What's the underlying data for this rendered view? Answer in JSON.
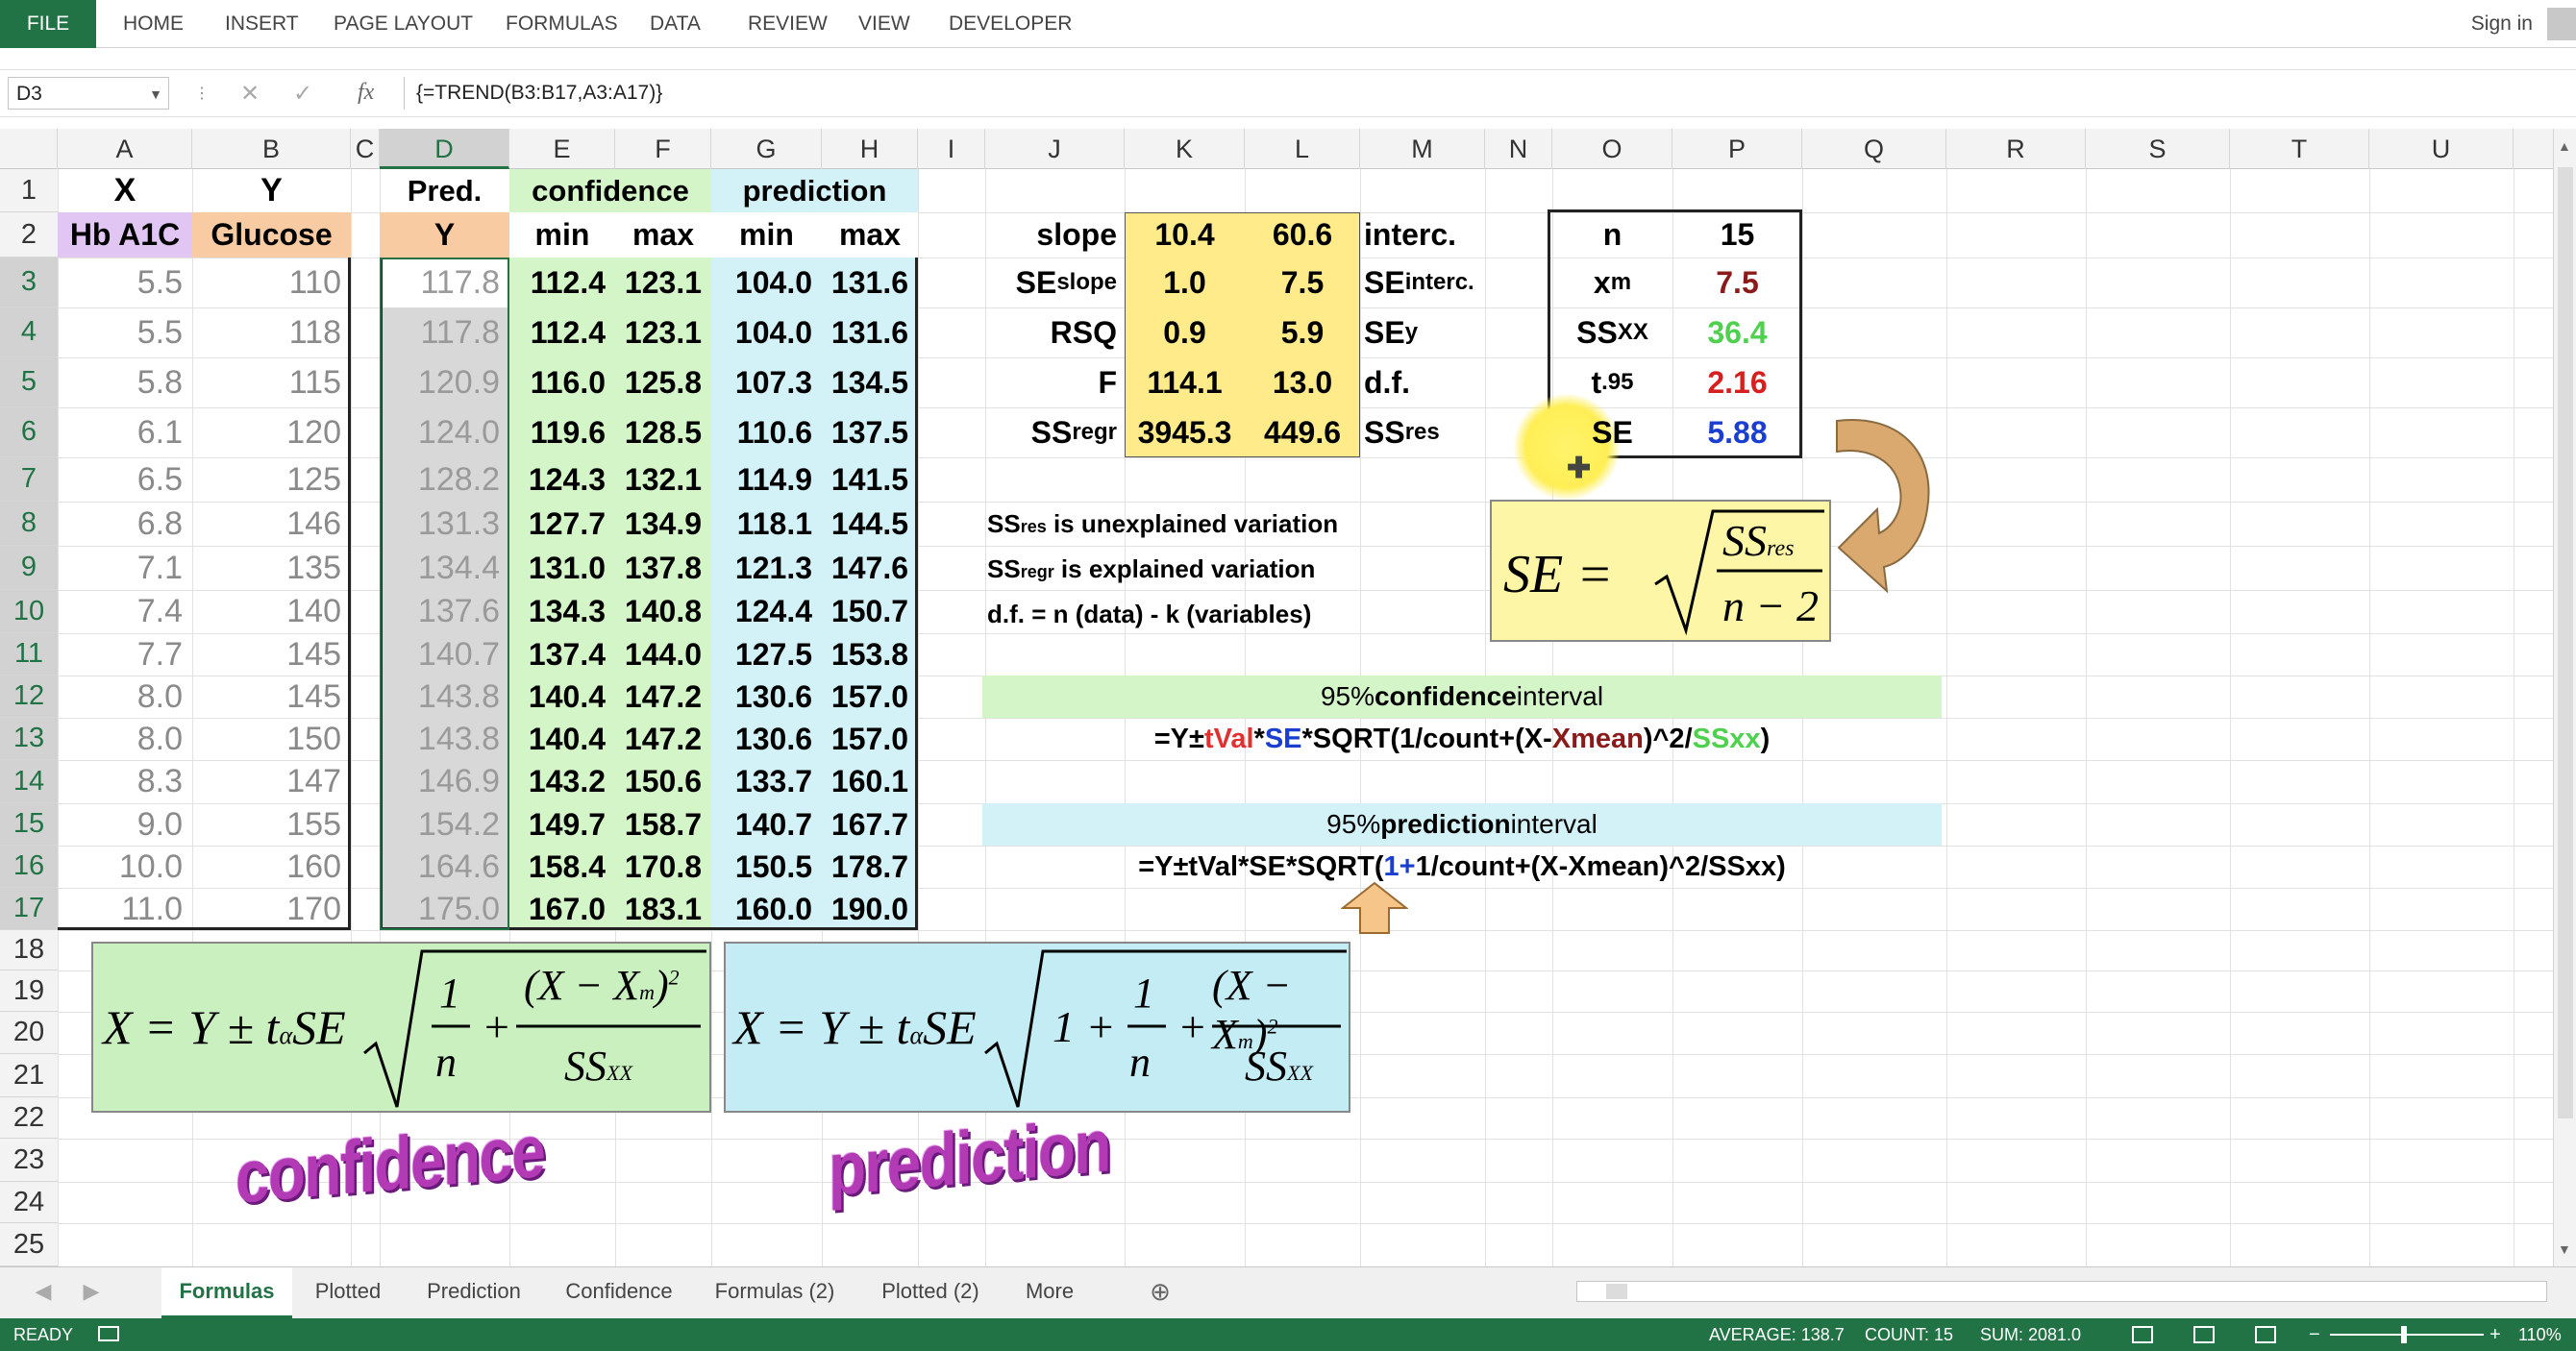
{
  "ribbon": {
    "file": "FILE",
    "tabs": [
      "HOME",
      "INSERT",
      "PAGE LAYOUT",
      "FORMULAS",
      "DATA",
      "REVIEW",
      "VIEW",
      "DEVELOPER"
    ],
    "signin": "Sign in"
  },
  "formula_bar": {
    "name_box": "D3",
    "cancel": "✕",
    "enter": "✓",
    "fx": "fx",
    "formula": "{=TREND(B3:B17,A3:A17)}"
  },
  "columns": [
    "A",
    "B",
    "C",
    "D",
    "E",
    "F",
    "G",
    "H",
    "I",
    "J",
    "K",
    "L",
    "M",
    "N",
    "O",
    "P",
    "Q",
    "R",
    "S",
    "T",
    "U"
  ],
  "rows": [
    "1",
    "2",
    "3",
    "4",
    "5",
    "6",
    "7",
    "8",
    "9",
    "10",
    "11",
    "12",
    "13",
    "14",
    "15",
    "16",
    "17",
    "18",
    "19",
    "20",
    "21",
    "22",
    "23",
    "24",
    "25"
  ],
  "headers": {
    "x": "X",
    "y": "Y",
    "hba1c": "Hb A1C",
    "glucose": "Glucose",
    "pred": "Pred.",
    "pred_y": "Y",
    "confidence": "confidence",
    "prediction": "prediction",
    "min": "min",
    "max": "max"
  },
  "table": [
    [
      "5.5",
      "110",
      "117.8",
      "112.4",
      "123.1",
      "104.0",
      "131.6"
    ],
    [
      "5.5",
      "118",
      "117.8",
      "112.4",
      "123.1",
      "104.0",
      "131.6"
    ],
    [
      "5.8",
      "115",
      "120.9",
      "116.0",
      "125.8",
      "107.3",
      "134.5"
    ],
    [
      "6.1",
      "120",
      "124.0",
      "119.6",
      "128.5",
      "110.6",
      "137.5"
    ],
    [
      "6.5",
      "125",
      "128.2",
      "124.3",
      "132.1",
      "114.9",
      "141.5"
    ],
    [
      "6.8",
      "146",
      "131.3",
      "127.7",
      "134.9",
      "118.1",
      "144.5"
    ],
    [
      "7.1",
      "135",
      "134.4",
      "131.0",
      "137.8",
      "121.3",
      "147.6"
    ],
    [
      "7.4",
      "140",
      "137.6",
      "134.3",
      "140.8",
      "124.4",
      "150.7"
    ],
    [
      "7.7",
      "145",
      "140.7",
      "137.4",
      "144.0",
      "127.5",
      "153.8"
    ],
    [
      "8.0",
      "145",
      "143.8",
      "140.4",
      "147.2",
      "130.6",
      "157.0"
    ],
    [
      "8.0",
      "150",
      "143.8",
      "140.4",
      "147.2",
      "130.6",
      "157.0"
    ],
    [
      "8.3",
      "147",
      "146.9",
      "143.2",
      "150.6",
      "133.7",
      "160.1"
    ],
    [
      "9.0",
      "155",
      "154.2",
      "149.7",
      "158.7",
      "140.7",
      "167.7"
    ],
    [
      "10.0",
      "160",
      "164.6",
      "158.4",
      "170.8",
      "150.5",
      "178.7"
    ],
    [
      "11.0",
      "170",
      "175.0",
      "167.0",
      "183.1",
      "160.0",
      "190.0"
    ]
  ],
  "stats": {
    "slope": "slope",
    "slope_val": "10.4",
    "interc_val": "60.6",
    "interc": "interc.",
    "se": "SE",
    "se_slope_sub": "slope",
    "se_slope_val": "1.0",
    "se_interc_val": "7.5",
    "se_interc_sub": "interc.",
    "rsq": "RSQ",
    "rsq_val": "0.9",
    "sey_val": "5.9",
    "se_y_sub": "y",
    "f": "F",
    "f_val": "114.1",
    "df_val": "13.0",
    "df": "d.f.",
    "ss": "SS",
    "ss_regr_sub": "regr",
    "ss_regr_val": "3945.3",
    "ss_res_val": "449.6",
    "ss_res_sub": "res"
  },
  "box": {
    "n": "n",
    "n_val": "15",
    "xm": "x",
    "xm_sub": "m",
    "xm_val": "7.5",
    "ssxx": "SS",
    "ssxx_sub": "XX",
    "ssxx_val": "36.4",
    "t": "t",
    "t_sub": ".95",
    "t_val": "2.16",
    "se": "SE",
    "se_val": "5.88"
  },
  "notes": {
    "res_label": "SS",
    "res_sub": "res",
    "res_text": " is unexplained variation",
    "regr_label": "SS",
    "regr_sub": "regr",
    "regr_text": " is explained variation",
    "df_text": "d.f. = n (data) - k (variables)"
  },
  "conf_interval": {
    "pre": "95% ",
    "bold": "confidence",
    "post": " interval",
    "f1": "=Y±",
    "f2": "tVal",
    "f3": "*",
    "f4": "SE",
    "f5": "*SQRT(1/count+(X-",
    "f6": "Xmean",
    "f7": ")^2/",
    "f8": "SSxx",
    "f9": ")"
  },
  "pred_interval": {
    "pre": "95% ",
    "bold": "prediction",
    "post": " interval",
    "f1": "=Y±tVal*SE*SQRT(",
    "f2": "1+",
    "f3": "1/count+(X-Xmean)^2/SSxx)"
  },
  "formulas": {
    "se_lhs": "SE =",
    "ss": "SS",
    "res": "res",
    "n2": "n − 2",
    "lhs": "X = Y ± t",
    "alpha": "α",
    "se": "SE",
    "one": "1",
    "plus": "+",
    "n": "n",
    "num": "(X − X",
    "m": "m",
    ")": ")",
    "two": "2",
    "ssxx": "SS",
    "xx": "XX",
    "onep": "1 +"
  },
  "wordart": {
    "confidence": "confidence",
    "prediction": "prediction"
  },
  "sheets": [
    "Formulas",
    "Plotted",
    "Prediction",
    "Confidence",
    "Formulas (2)",
    "Plotted (2)",
    "More"
  ],
  "status": {
    "ready": "READY",
    "average": "AVERAGE: 138.7",
    "count": "COUNT: 15",
    "sum": "SUM: 2081.0",
    "zoom": "110%"
  },
  "colors": {
    "excel_green": "#217346",
    "yellow": "#ffeb8a",
    "orange": "#f8cba3",
    "purple": "#e1c6f4",
    "green": "#d4f5c8",
    "cyan": "#d3f2f8",
    "formula_yellow": "#fdf6a6",
    "formula_green": "#cbf0c0",
    "formula_cyan": "#c3ecf4"
  }
}
